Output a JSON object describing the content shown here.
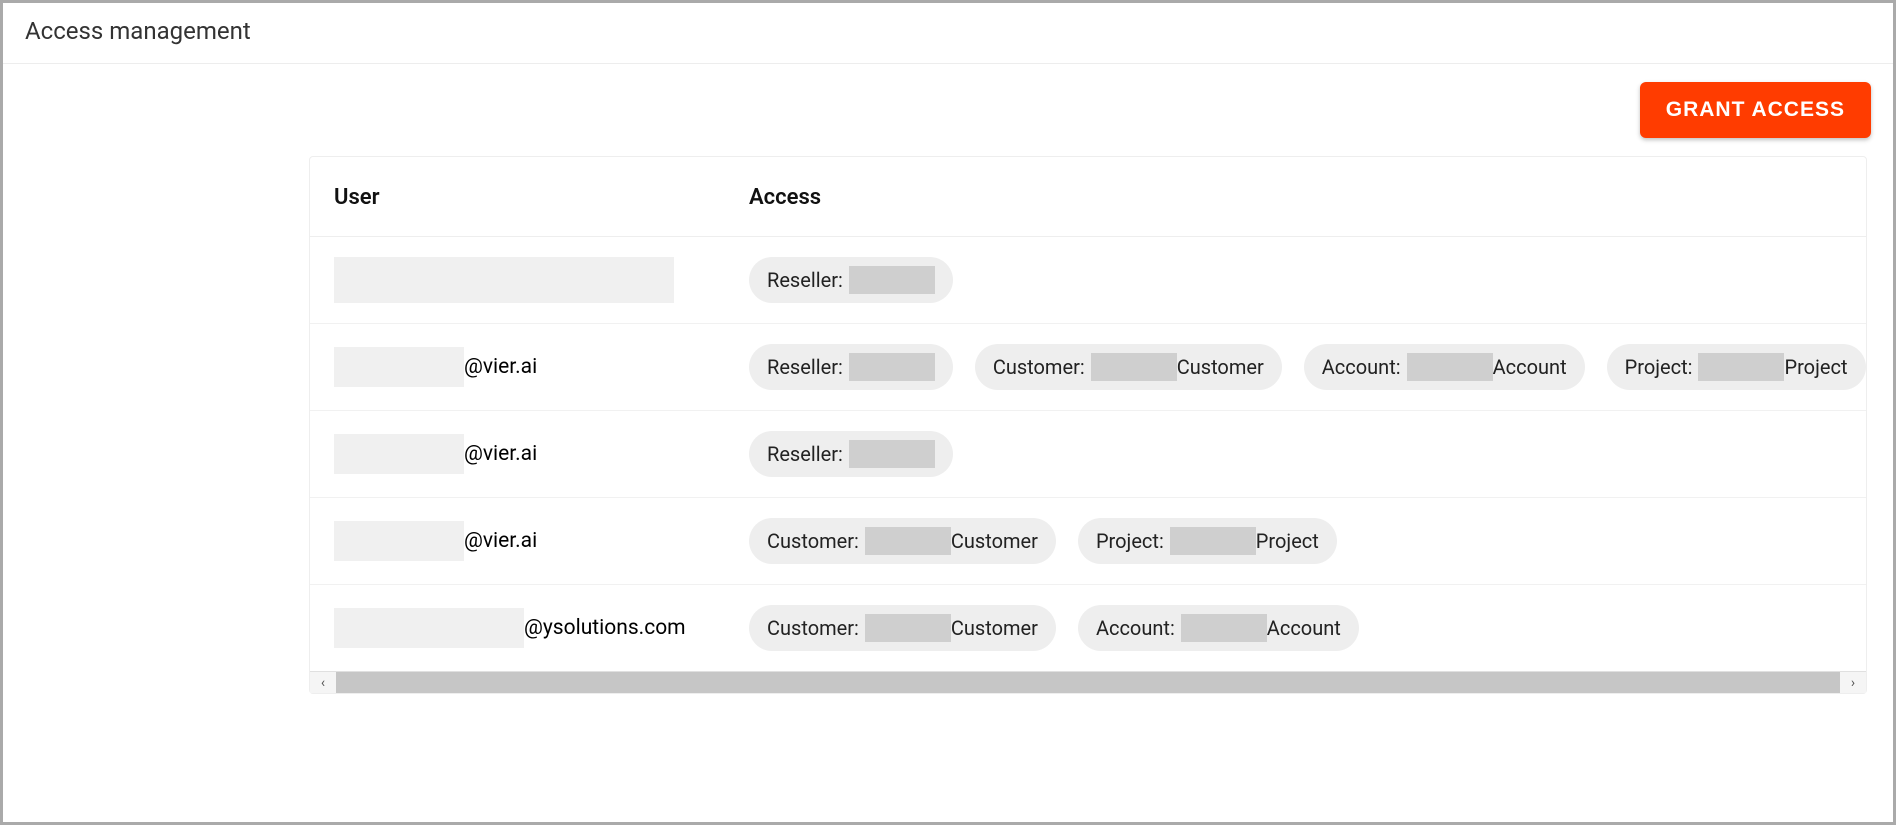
{
  "header": {
    "title": "Access management"
  },
  "actions": {
    "grant_access": "GRANT ACCESS"
  },
  "table": {
    "columns": {
      "user": "User",
      "access": "Access"
    },
    "rows": [
      {
        "user_suffix": "",
        "user_redact_class": "w1 w1b",
        "chips": [
          {
            "kind": "Reseller:",
            "suffix": ""
          }
        ]
      },
      {
        "user_suffix": "@vier.ai",
        "user_redact_class": "w2",
        "chips": [
          {
            "kind": "Reseller:",
            "suffix": ""
          },
          {
            "kind": "Customer:",
            "suffix": "Customer"
          },
          {
            "kind": "Account:",
            "suffix": "Account"
          },
          {
            "kind": "Project:",
            "suffix": "Project"
          }
        ]
      },
      {
        "user_suffix": "@vier.ai",
        "user_redact_class": "w2",
        "chips": [
          {
            "kind": "Reseller:",
            "suffix": ""
          }
        ]
      },
      {
        "user_suffix": "@vier.ai",
        "user_redact_class": "w2",
        "chips": [
          {
            "kind": "Customer:",
            "suffix": "Customer"
          },
          {
            "kind": "Project:",
            "suffix": "Project"
          }
        ]
      },
      {
        "user_suffix": "@ysolutions.com",
        "user_redact_class": "w3",
        "chips": [
          {
            "kind": "Customer:",
            "suffix": "Customer"
          },
          {
            "kind": "Account:",
            "suffix": "Account"
          }
        ]
      }
    ]
  },
  "scrollbar": {
    "left_glyph": "‹",
    "right_glyph": "›"
  }
}
